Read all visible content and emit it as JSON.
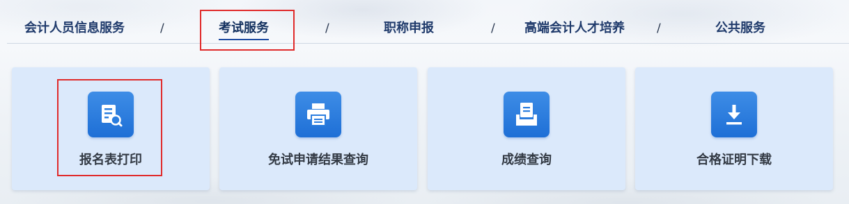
{
  "nav": {
    "tabs": [
      {
        "label": "会计人员信息服务"
      },
      {
        "label": "考试服务"
      },
      {
        "label": "职称申报"
      },
      {
        "label": "高端会计人才培养"
      },
      {
        "label": "公共服务"
      }
    ],
    "separator": "/",
    "active_tab": "考试服务"
  },
  "services": [
    {
      "label": "报名表打印",
      "icon": "document-search-icon"
    },
    {
      "label": "免试申请结果查询",
      "icon": "printer-icon"
    },
    {
      "label": "成绩查询",
      "icon": "inbox-tray-icon"
    },
    {
      "label": "合格证明下载",
      "icon": "download-icon"
    }
  ],
  "colors": {
    "accent": "#1b4aa0",
    "highlight": "#e02a2a",
    "card_bg": "#dbe9fb",
    "icon_bg": "#2a7ddf",
    "tab_text": "#1f3a6b"
  }
}
